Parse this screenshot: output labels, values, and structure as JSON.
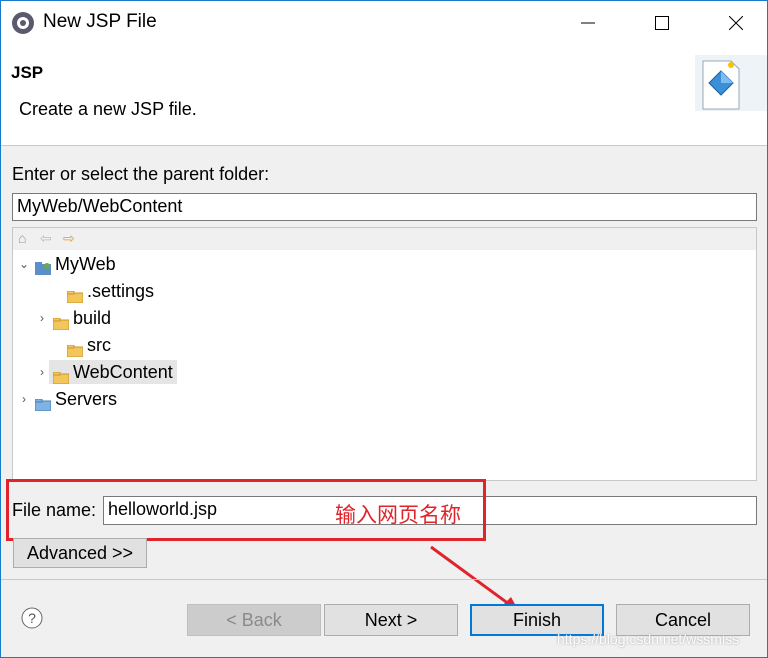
{
  "window": {
    "title": "New JSP File"
  },
  "banner": {
    "title": "JSP",
    "description": "Create a new JSP file."
  },
  "parent_folder": {
    "label": "Enter or select the parent folder:",
    "value": "MyWeb/WebContent"
  },
  "tree": {
    "items": [
      {
        "label": "MyWeb"
      },
      {
        "label": ".settings"
      },
      {
        "label": "build"
      },
      {
        "label": "src"
      },
      {
        "label": "WebContent"
      },
      {
        "label": "Servers"
      }
    ]
  },
  "file_name": {
    "label": "File name:",
    "value": "helloworld.jsp"
  },
  "annotation": {
    "text": "输入网页名称",
    "color": "#e0242b"
  },
  "buttons": {
    "advanced": "Advanced >>",
    "back": "< Back",
    "next": "Next >",
    "finish": "Finish",
    "cancel": "Cancel"
  },
  "watermark": "https://blog.csdn.net/wssmiss",
  "colors": {
    "accent": "#0078d7",
    "annotation": "#e0242b"
  }
}
